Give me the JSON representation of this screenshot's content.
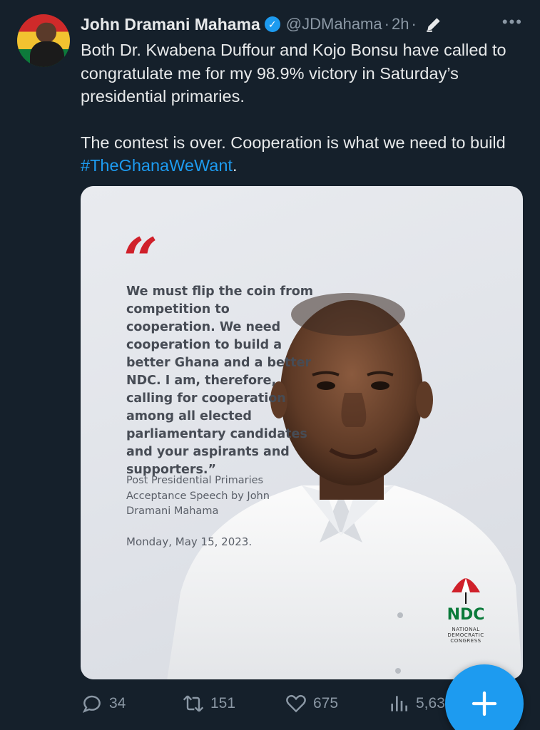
{
  "author": {
    "name": "John Dramani Mahama",
    "handle": "@JDMahama",
    "time": "2h",
    "separator": "·",
    "more": "•••"
  },
  "tweet": {
    "paragraph1": "Both Dr. Kwabena Duffour and Kojo Bonsu have called to congratulate me for my 98.9% victory in Saturday’s presidential primaries.",
    "paragraph2_text": "The contest is over. Cooperation is what we need to build ",
    "hashtag": "#TheGhanaWeWant",
    "paragraph2_end": "."
  },
  "media": {
    "quote_mark": "“",
    "quote": "We must flip the coin from competition to cooperation. We need cooperation to build a better Ghana and a better NDC. I am, therefore, calling for cooperation among all elected parliamentary candidates and your aspirants and supporters.”",
    "source": "Post Presidential Primaries Acceptance Speech by John Dramani Mahama",
    "date": "Monday, May 15, 2023.",
    "logo_text": "NDC",
    "logo_sub1": "NATIONAL",
    "logo_sub2": "DEMOCRATIC",
    "logo_sub3": "CONGRESS"
  },
  "actions": {
    "replies": "34",
    "reposts": "151",
    "likes": "675",
    "views": "5,63"
  },
  "colors": {
    "accent": "#1d9bf0",
    "background": "#15202b",
    "muted": "#8b98a5",
    "ndc_red": "#d0202a",
    "ndc_green": "#0a7a3a"
  },
  "icons": [
    "verified-icon",
    "edit-icon",
    "more-icon",
    "reply-icon",
    "repost-icon",
    "like-icon",
    "views-icon",
    "plus-icon"
  ]
}
